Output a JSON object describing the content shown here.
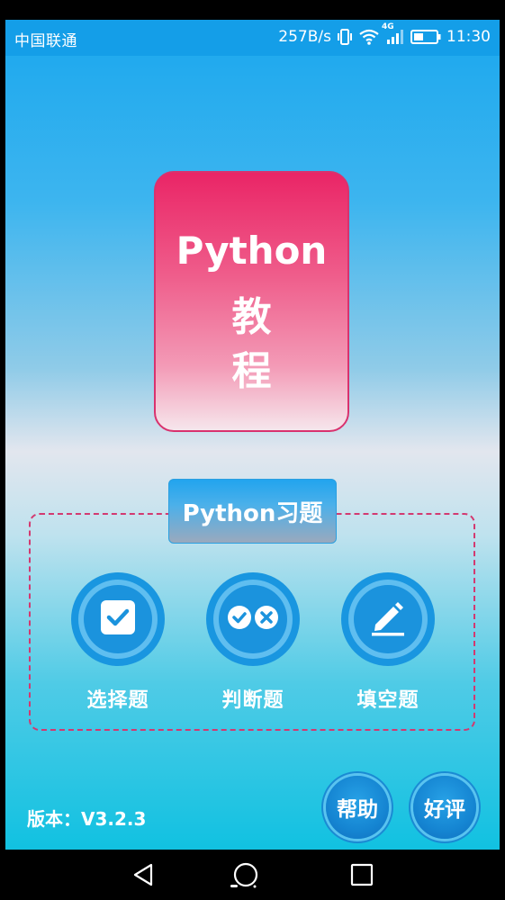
{
  "status_bar": {
    "carrier": "中国联通",
    "net_speed": "257B/s",
    "network_type": "4G",
    "time": "11:30"
  },
  "logo": {
    "line1": "Python",
    "line2": "教",
    "line3": "程"
  },
  "exercises": {
    "title": "Python习题",
    "items": [
      {
        "label": "选择题",
        "icon": "checkbox-icon"
      },
      {
        "label": "判断题",
        "icon": "true-false-icon"
      },
      {
        "label": "填空题",
        "icon": "pencil-icon"
      }
    ]
  },
  "footer": {
    "version": "版本：V3.2.3",
    "help_label": "帮助",
    "rate_label": "好评"
  },
  "colors": {
    "status_bar": "#149ee8",
    "logo_card": "#ea2566",
    "dashed_border": "#d33970",
    "circle_button": "#1996e0"
  }
}
